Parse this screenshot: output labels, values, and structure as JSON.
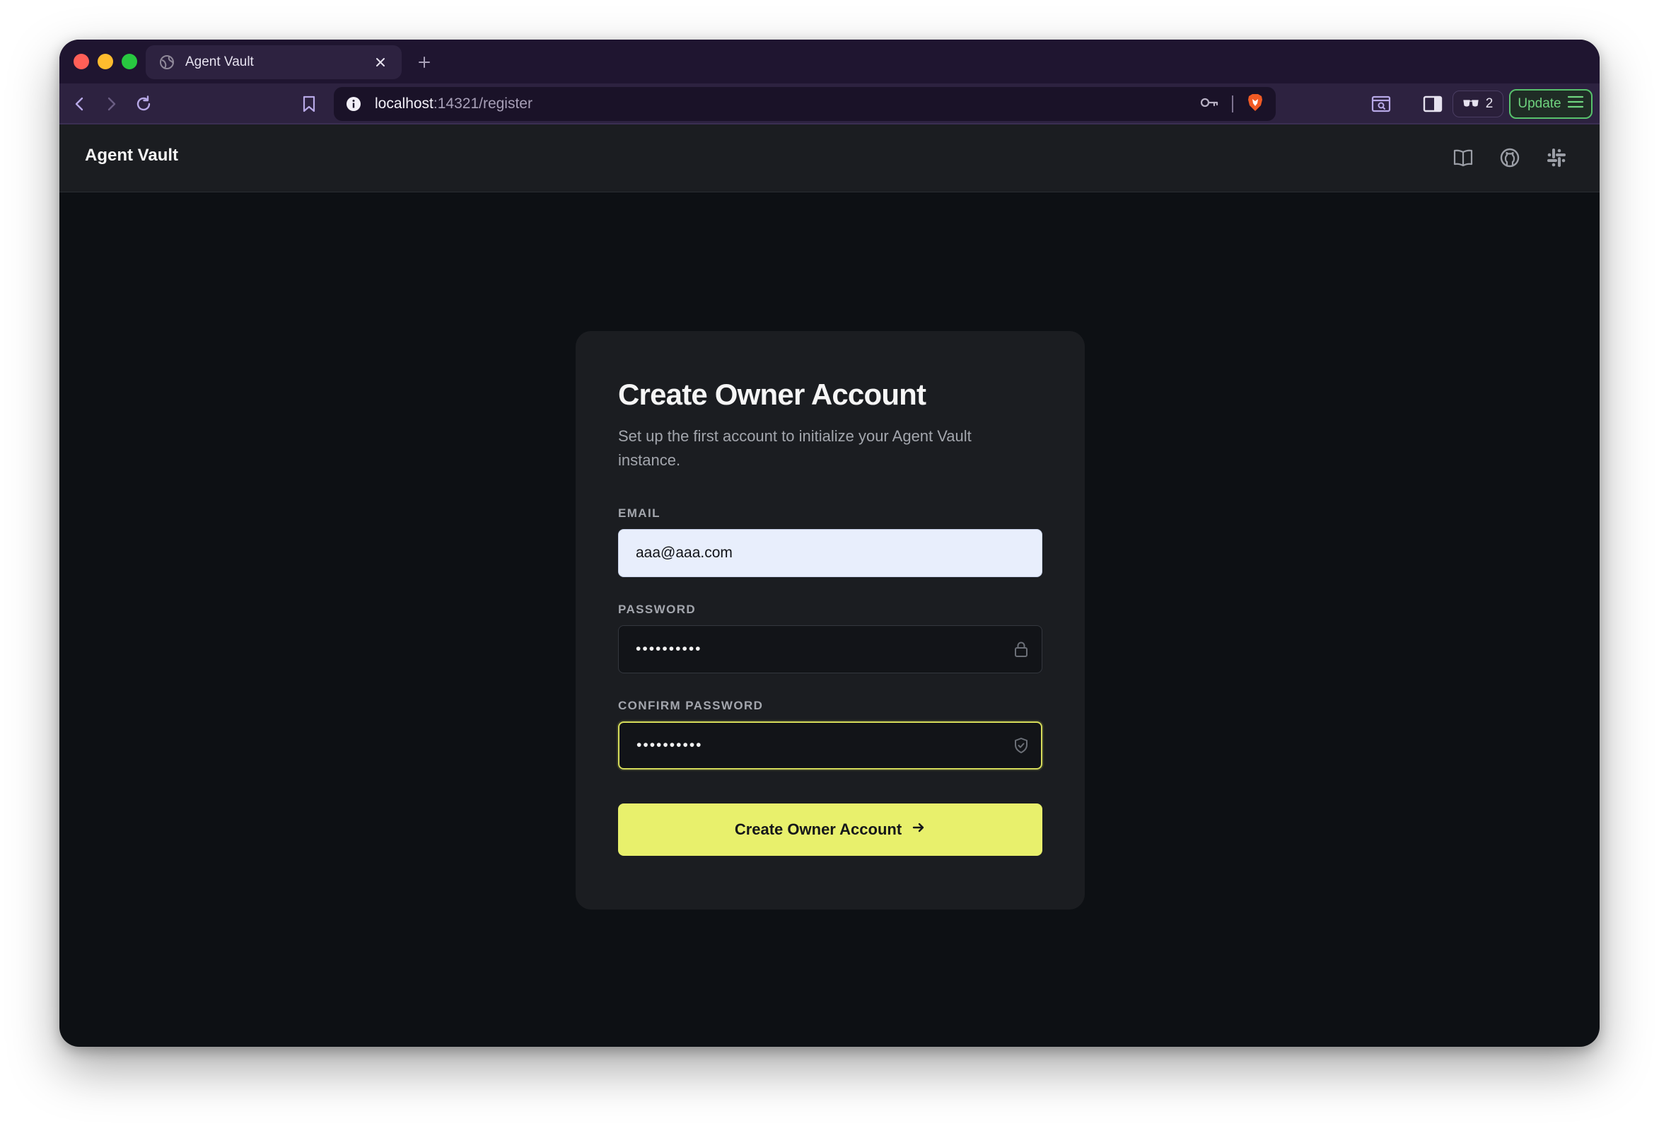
{
  "browser": {
    "tab_title": "Agent Vault",
    "url_host": "localhost",
    "url_path": ":14321/register",
    "wallet_count": "2",
    "update_label": "Update"
  },
  "app": {
    "brand": "Agent Vault"
  },
  "form": {
    "title": "Create Owner Account",
    "subtitle": "Set up the first account to initialize your Agent Vault instance.",
    "email_label": "EMAIL",
    "email_value": "aaa@aaa.com",
    "password_label": "PASSWORD",
    "password_value": "••••••••••",
    "confirm_label": "CONFIRM PASSWORD",
    "confirm_value": "••••••••••",
    "submit_label": "Create Owner Account"
  },
  "colors": {
    "accent": "#e8f06c",
    "background": "#0d1014",
    "card": "#1b1d21",
    "browser_chrome": "#2d2240"
  },
  "icons": {
    "tab": "globe-icon",
    "close": "close-icon",
    "new_tab": "plus-icon",
    "back": "chevron-left-icon",
    "forward": "chevron-right-icon",
    "reload": "reload-icon",
    "bookmark": "bookmark-icon",
    "site_info": "info-icon",
    "password_key": "key-icon",
    "brave": "brave-shield-icon",
    "screenshot": "screenshot-icon",
    "sidebar": "sidebar-icon",
    "wallet": "wallet-icon",
    "menu": "hamburger-icon",
    "docs": "book-icon",
    "github": "github-icon",
    "slack": "slack-icon",
    "lock": "lock-icon",
    "shield": "shield-check-icon",
    "arrow": "arrow-right-icon"
  }
}
